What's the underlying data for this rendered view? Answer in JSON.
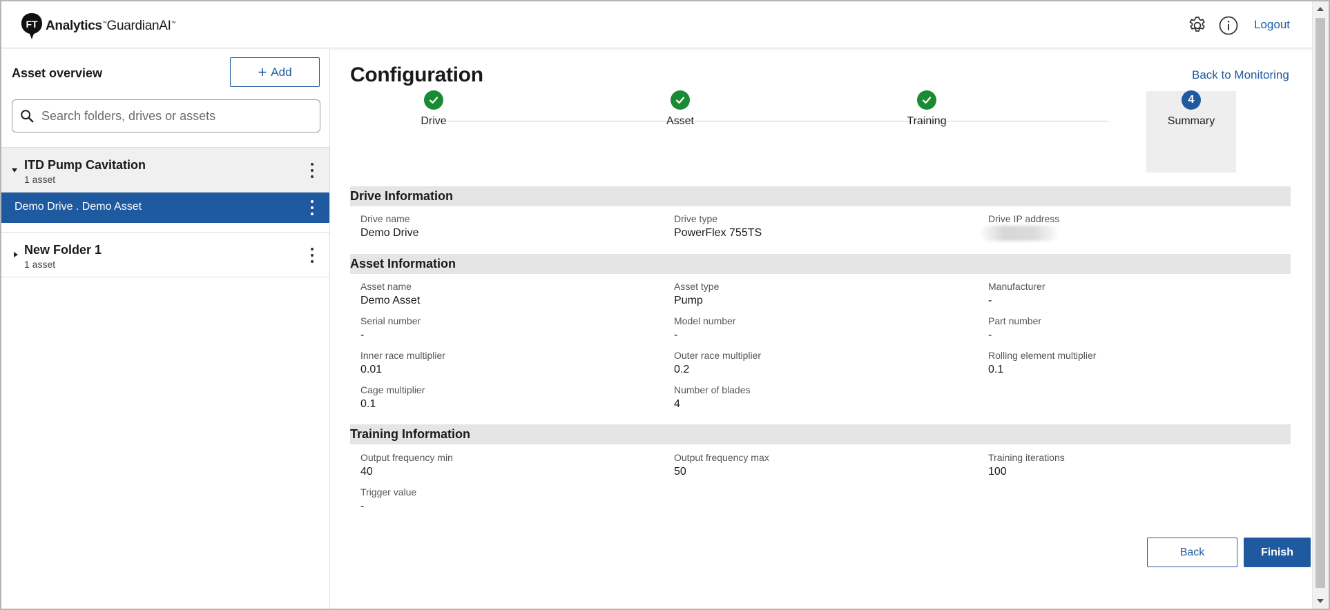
{
  "header": {
    "brand_bold": "Analytics",
    "brand_product": "GuardianAI",
    "brand_tm": "™",
    "logo_letters": "FT",
    "logout_label": "Logout"
  },
  "sidebar": {
    "title": "Asset overview",
    "add_label": "Add",
    "search_placeholder": "Search folders, drives or assets",
    "folders": [
      {
        "name": "ITD Pump Cavitation",
        "count": "1 asset",
        "expanded": true,
        "children": [
          {
            "label": "Demo Drive . Demo Asset",
            "selected": true
          }
        ]
      },
      {
        "name": "New Folder 1",
        "count": "1 asset",
        "expanded": false
      }
    ]
  },
  "main": {
    "title": "Configuration",
    "back_to_monitoring": "Back to Monitoring",
    "steps": [
      {
        "label": "Drive",
        "state": "done"
      },
      {
        "label": "Asset",
        "state": "done"
      },
      {
        "label": "Training",
        "state": "done"
      },
      {
        "label": "Summary",
        "state": "current",
        "number": "4"
      }
    ],
    "drive_section": {
      "heading": "Drive Information",
      "fields": [
        {
          "label": "Drive name",
          "value": "Demo Drive"
        },
        {
          "label": "Drive type",
          "value": "PowerFlex 755TS"
        },
        {
          "label": "Drive IP address",
          "value": ""
        }
      ]
    },
    "asset_section": {
      "heading": "Asset Information",
      "fields": [
        {
          "label": "Asset name",
          "value": "Demo Asset"
        },
        {
          "label": "Asset type",
          "value": "Pump"
        },
        {
          "label": "Manufacturer",
          "value": "-"
        },
        {
          "label": "Serial number",
          "value": "-"
        },
        {
          "label": "Model number",
          "value": "-"
        },
        {
          "label": "Part number",
          "value": "-"
        },
        {
          "label": "Inner race multiplier",
          "value": "0.01"
        },
        {
          "label": "Outer race multiplier",
          "value": "0.2"
        },
        {
          "label": "Rolling element multiplier",
          "value": "0.1"
        },
        {
          "label": "Cage multiplier",
          "value": "0.1"
        },
        {
          "label": "Number of blades",
          "value": "4"
        }
      ]
    },
    "training_section": {
      "heading": "Training Information",
      "fields": [
        {
          "label": "Output frequency min",
          "value": "40"
        },
        {
          "label": "Output frequency max",
          "value": "50"
        },
        {
          "label": "Training iterations",
          "value": "100"
        },
        {
          "label": "Trigger value",
          "value": "-"
        }
      ]
    },
    "back_label": "Back",
    "finish_label": "Finish"
  },
  "colors": {
    "accent": "#1f5aa0",
    "step_done": "#1a8a34",
    "section_bg": "#e5e5e5"
  },
  "icons": [
    "search-icon",
    "gear-icon",
    "info-icon",
    "plus-icon",
    "check-icon",
    "kebab-icon",
    "caret-icon"
  ]
}
